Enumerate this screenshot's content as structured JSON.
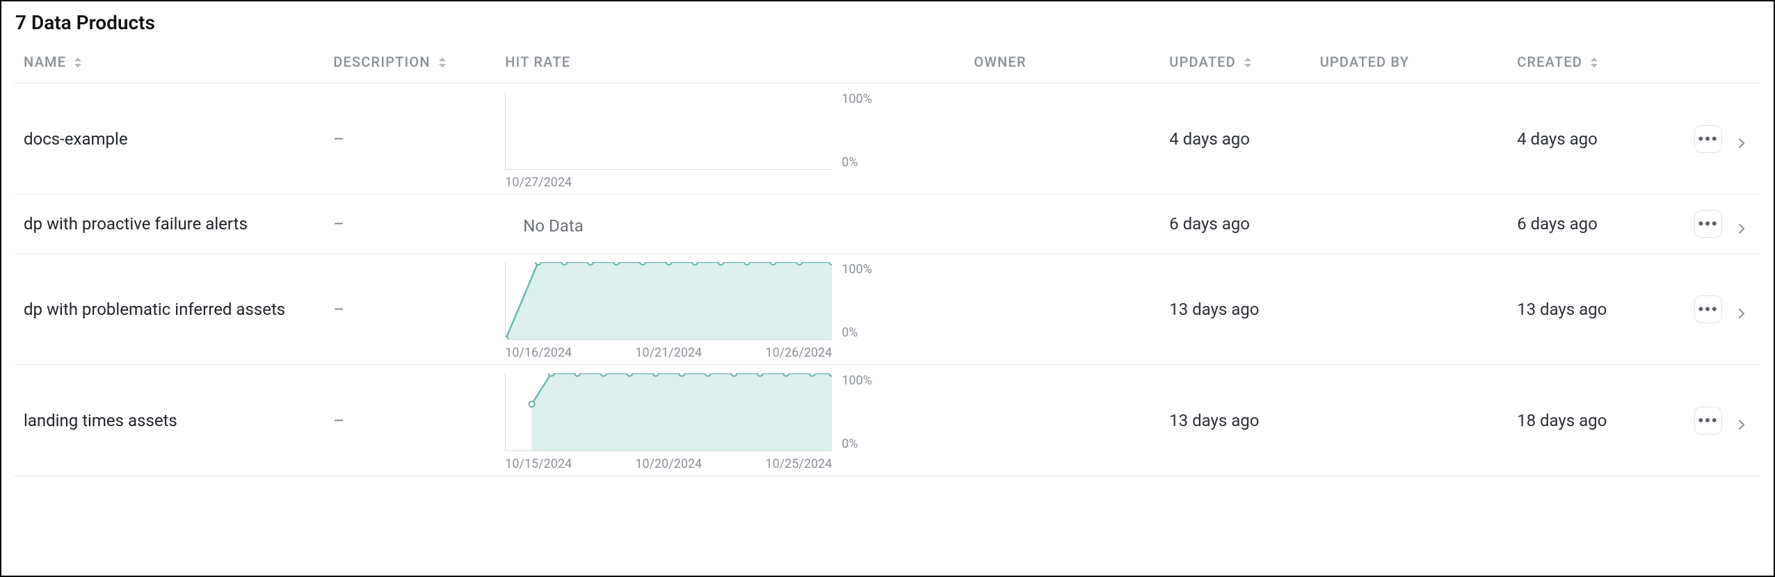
{
  "page": {
    "title": "7 Data Products"
  },
  "columns": {
    "name": "Name",
    "description": "Description",
    "hit_rate": "Hit Rate",
    "owner": "Owner",
    "updated": "Updated",
    "updated_by": "Updated By",
    "created": "Created"
  },
  "y_labels": {
    "top": "100%",
    "bottom": "0%"
  },
  "rows": [
    {
      "name": "docs-example",
      "description": "–",
      "owner": "",
      "updated": "4 days ago",
      "updated_by": "",
      "created": "4 days ago",
      "hit_rate": {
        "type": "empty-chart",
        "x_labels": [
          "10/27/2024"
        ]
      }
    },
    {
      "name": "dp with proactive failure alerts",
      "description": "–",
      "owner": "",
      "updated": "6 days ago",
      "updated_by": "",
      "created": "6 days ago",
      "hit_rate": {
        "type": "no-data",
        "text": "No Data"
      }
    },
    {
      "name": "dp with problematic inferred assets",
      "description": "–",
      "owner": "",
      "updated": "13 days ago",
      "updated_by": "",
      "created": "13 days ago",
      "hit_rate": {
        "type": "chart",
        "x_labels": [
          "10/16/2024",
          "10/21/2024",
          "10/26/2024"
        ],
        "points": [
          {
            "x": 0,
            "y": 0
          },
          {
            "x": 10,
            "y": 100
          },
          {
            "x": 18,
            "y": 100
          },
          {
            "x": 26,
            "y": 100
          },
          {
            "x": 34,
            "y": 100
          },
          {
            "x": 42,
            "y": 100
          },
          {
            "x": 50,
            "y": 100
          },
          {
            "x": 58,
            "y": 100
          },
          {
            "x": 66,
            "y": 100
          },
          {
            "x": 74,
            "y": 100
          },
          {
            "x": 82,
            "y": 100
          },
          {
            "x": 90,
            "y": 100
          },
          {
            "x": 100,
            "y": 100
          }
        ]
      }
    },
    {
      "name": "landing times assets",
      "description": "–",
      "owner": "",
      "updated": "13 days ago",
      "updated_by": "",
      "created": "18 days ago",
      "hit_rate": {
        "type": "chart",
        "x_labels": [
          "10/15/2024",
          "10/20/2024",
          "10/25/2024"
        ],
        "points": [
          {
            "x": 8,
            "y": 60
          },
          {
            "x": 14,
            "y": 100
          },
          {
            "x": 22,
            "y": 100
          },
          {
            "x": 30,
            "y": 100
          },
          {
            "x": 38,
            "y": 100
          },
          {
            "x": 46,
            "y": 100
          },
          {
            "x": 54,
            "y": 100
          },
          {
            "x": 62,
            "y": 100
          },
          {
            "x": 70,
            "y": 100
          },
          {
            "x": 78,
            "y": 100
          },
          {
            "x": 86,
            "y": 100
          },
          {
            "x": 94,
            "y": 100
          },
          {
            "x": 100,
            "y": 100
          }
        ]
      }
    }
  ],
  "chart_data": [
    {
      "row": "docs-example",
      "type": "line",
      "title": "Hit Rate",
      "ylabel": "%",
      "ylim": [
        0,
        100
      ],
      "x": [
        "10/27/2024"
      ],
      "series": [
        {
          "name": "hit_rate",
          "values": [
            null
          ]
        }
      ]
    },
    {
      "row": "dp with proactive failure alerts",
      "type": "line",
      "title": "Hit Rate",
      "note": "No Data"
    },
    {
      "row": "dp with problematic inferred assets",
      "type": "area",
      "title": "Hit Rate",
      "ylabel": "%",
      "ylim": [
        0,
        100
      ],
      "x_range": [
        "10/16/2024",
        "10/26/2024"
      ],
      "x_tick_labels": [
        "10/16/2024",
        "10/21/2024",
        "10/26/2024"
      ],
      "series": [
        {
          "name": "hit_rate",
          "values": [
            0,
            100,
            100,
            100,
            100,
            100,
            100,
            100,
            100,
            100,
            100,
            100,
            100
          ]
        }
      ]
    },
    {
      "row": "landing times assets",
      "type": "area",
      "title": "Hit Rate",
      "ylabel": "%",
      "ylim": [
        0,
        100
      ],
      "x_range": [
        "10/15/2024",
        "10/25/2024"
      ],
      "x_tick_labels": [
        "10/15/2024",
        "10/20/2024",
        "10/25/2024"
      ],
      "series": [
        {
          "name": "hit_rate",
          "values": [
            60,
            100,
            100,
            100,
            100,
            100,
            100,
            100,
            100,
            100,
            100,
            100,
            100
          ]
        }
      ]
    }
  ]
}
